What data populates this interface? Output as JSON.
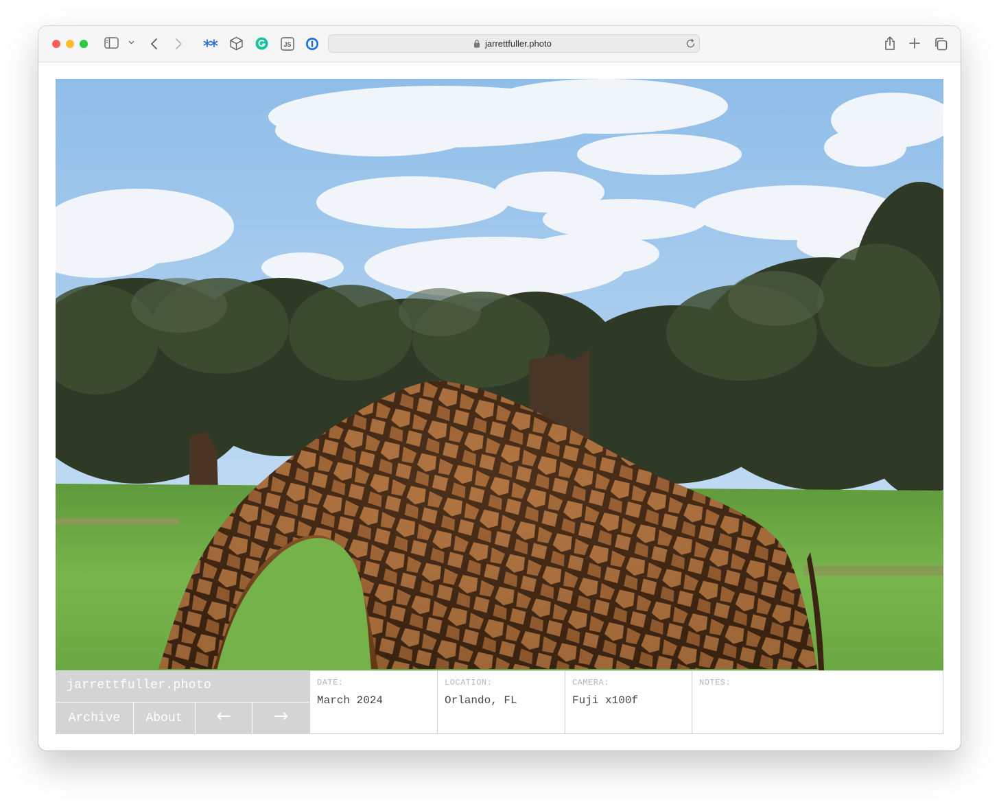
{
  "browser": {
    "url": "jarrettfuller.photo",
    "extensions": [
      "asterisk-extension-icon",
      "cube-extension-icon",
      "grammarly-extension-icon",
      "js-extension-icon",
      "password-manager-extension-icon"
    ],
    "js_badge": "JS"
  },
  "site": {
    "title": "jarrettfuller.photo",
    "nav": {
      "archive": "Archive",
      "about": "About",
      "prev": "←",
      "next": "→"
    },
    "photo": {
      "subject": "giraffe-grazing-photo"
    },
    "meta": [
      {
        "label": "DATE:",
        "value": "March 2024"
      },
      {
        "label": "LOCATION:",
        "value": "Orlando, FL"
      },
      {
        "label": "CAMERA:",
        "value": "Fuji x100f"
      },
      {
        "label": "NOTES:",
        "value": ""
      }
    ]
  },
  "colors": {
    "nav_bg": "#d4d4d4",
    "nav_text": "#ffffff",
    "label_text": "#b4b4b4",
    "value_text": "#444444"
  }
}
